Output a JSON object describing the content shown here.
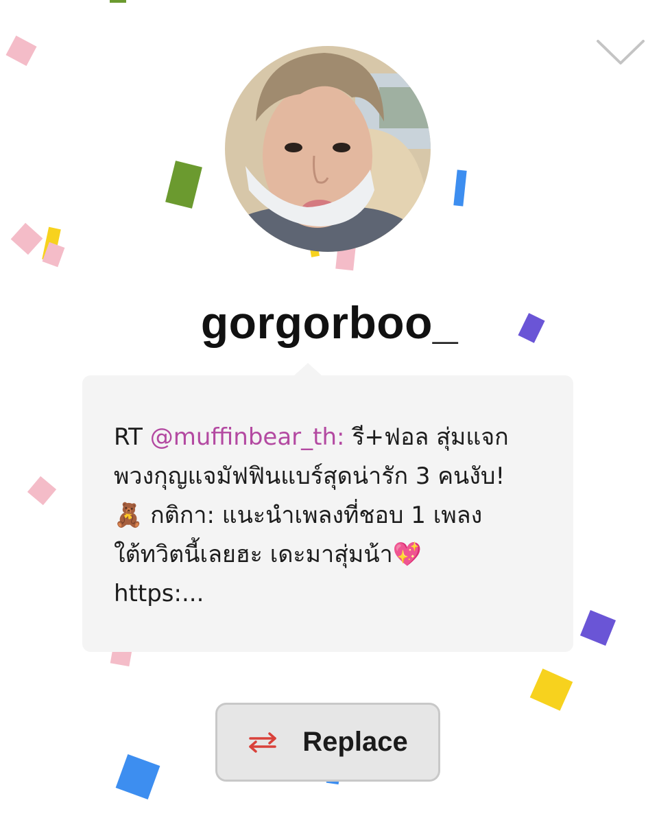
{
  "profile": {
    "username": "gorgorboo_",
    "avatar_icon": "profile-photo"
  },
  "tweet": {
    "prefix": "RT ",
    "mention": "@muffinbear_th:",
    "line1_rest": " รี+ฟอล สุ่มแจก",
    "line2": "พวงกุญแจมัฟฟินแบร์สุดน่ารัก 3 คนงับ!",
    "line3_emoji": "🧸",
    "line3_text": " กติกา: แนะนำเพลงที่ชอบ 1 เพลง",
    "line4_text": "ใต้ทวิตนี้เลยฮะ เดะมาสุ่มน้า",
    "line4_emoji": "💖",
    "line5": "https:..."
  },
  "actions": {
    "replace_label": "Replace",
    "replace_icon": "swap-arrows-icon",
    "collapse_icon": "chevron-down-icon"
  },
  "colors": {
    "mention": "#b349a1",
    "swap_icon": "#d9413a",
    "confetti_pink": "#f4bcc8",
    "confetti_green": "#6b9a2f",
    "confetti_blue": "#3d8ef0",
    "confetti_purple": "#6a55d6",
    "confetti_yellow": "#f7d21e"
  }
}
